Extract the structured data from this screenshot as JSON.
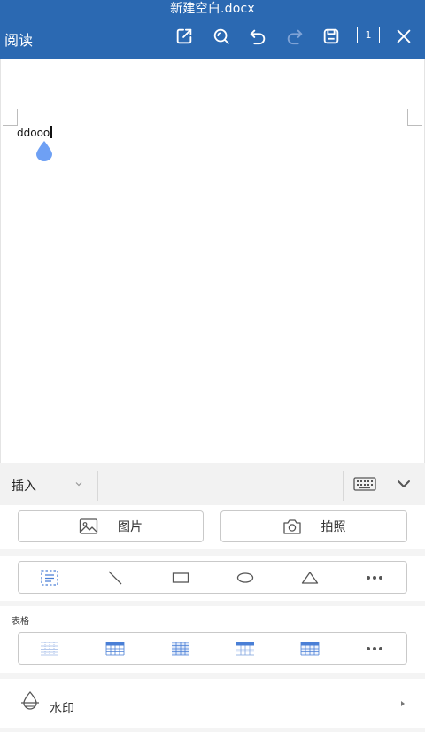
{
  "header": {
    "doc_title": "新建空白.docx",
    "read_label": "阅读",
    "page_number": "1",
    "icons": [
      "share-icon",
      "search-icon",
      "undo-icon",
      "redo-icon",
      "save-icon",
      "page-count-icon",
      "close-icon"
    ]
  },
  "document": {
    "text": "ddooo"
  },
  "panel": {
    "insert_label": "插入",
    "picture_label": "图片",
    "camera_label": "拍照",
    "table_label": "表格",
    "watermark_label": "水印"
  },
  "colors": {
    "topbar": "#2b69b2",
    "accent": "#4a7fd6",
    "drop": "#6ea0f4"
  }
}
